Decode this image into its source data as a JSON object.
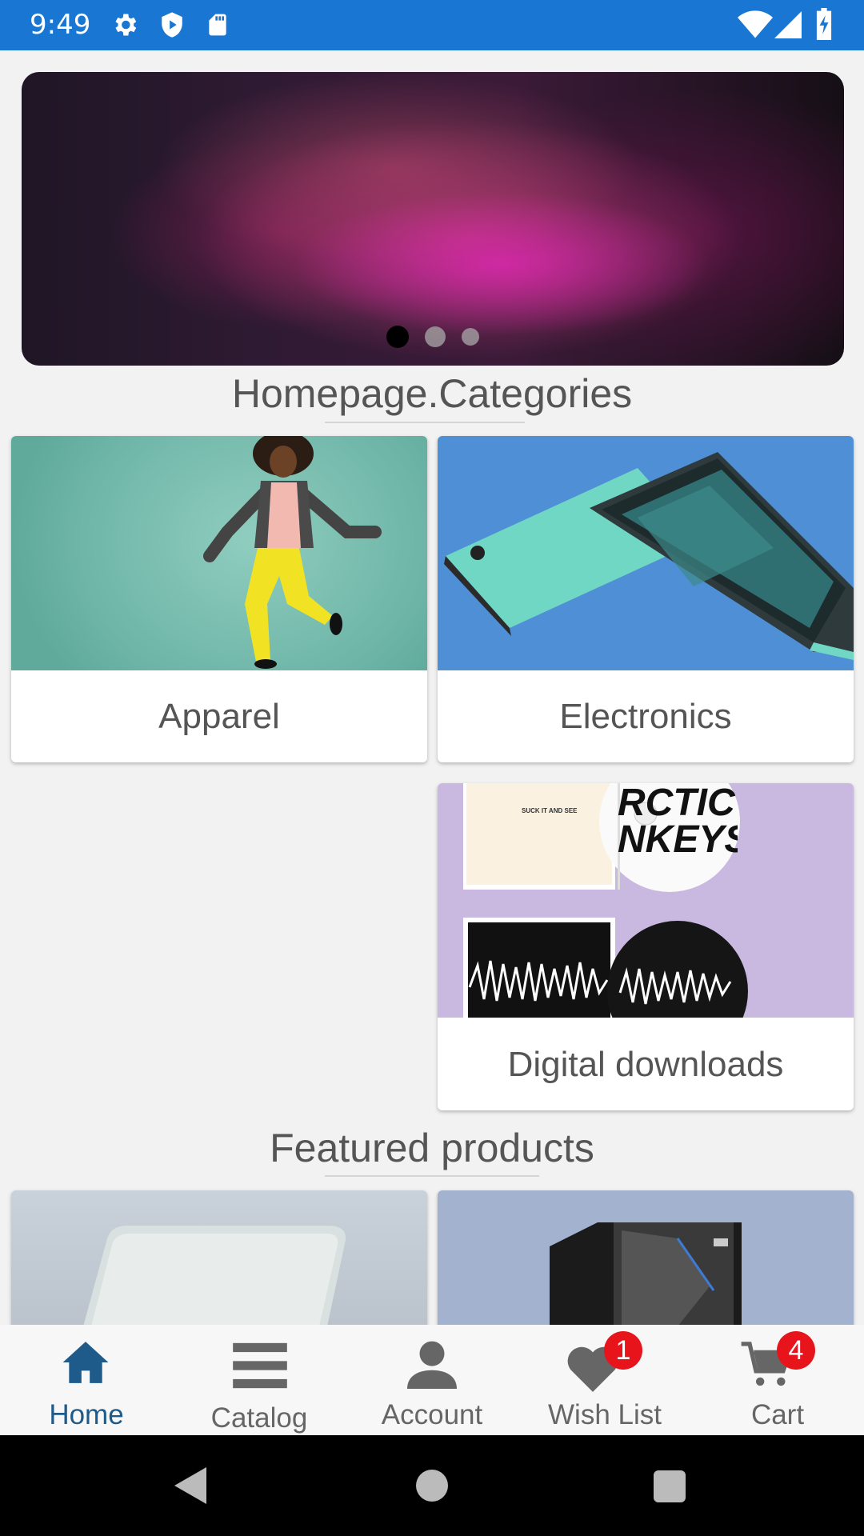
{
  "status_bar": {
    "time": "9:49",
    "left_icons": [
      "gear-icon",
      "shield-play-icon",
      "sd-card-icon"
    ],
    "right_icons": [
      "wifi-icon",
      "signal-icon",
      "battery-charging-icon"
    ],
    "color": "#1976d2"
  },
  "banner": {
    "slide_count": 3,
    "active_slide": 1
  },
  "categories": {
    "title": "Homepage.Categories",
    "items": [
      {
        "label": "Apparel"
      },
      {
        "label": "Electronics"
      },
      {
        "label": "Digital downloads"
      }
    ],
    "album_text": "SUCK IT AND SEE",
    "album_band": "RCTIC NKEYS"
  },
  "featured": {
    "title": "Featured products"
  },
  "bottom_nav": {
    "active_color": "#1e5a8a",
    "inactive_color": "#666666",
    "badge_color": "#e8141c",
    "items": [
      {
        "label": "Home",
        "icon": "home-icon",
        "active": true
      },
      {
        "label": "Catalog",
        "icon": "menu-icon",
        "active": false
      },
      {
        "label": "Account",
        "icon": "person-icon",
        "active": false
      },
      {
        "label": "Wish List",
        "icon": "heart-icon",
        "badge": "1",
        "active": false
      },
      {
        "label": "Cart",
        "icon": "cart-icon",
        "badge": "4",
        "active": false
      }
    ]
  },
  "system_nav": [
    "back-icon",
    "home-circle-icon",
    "recents-icon"
  ]
}
